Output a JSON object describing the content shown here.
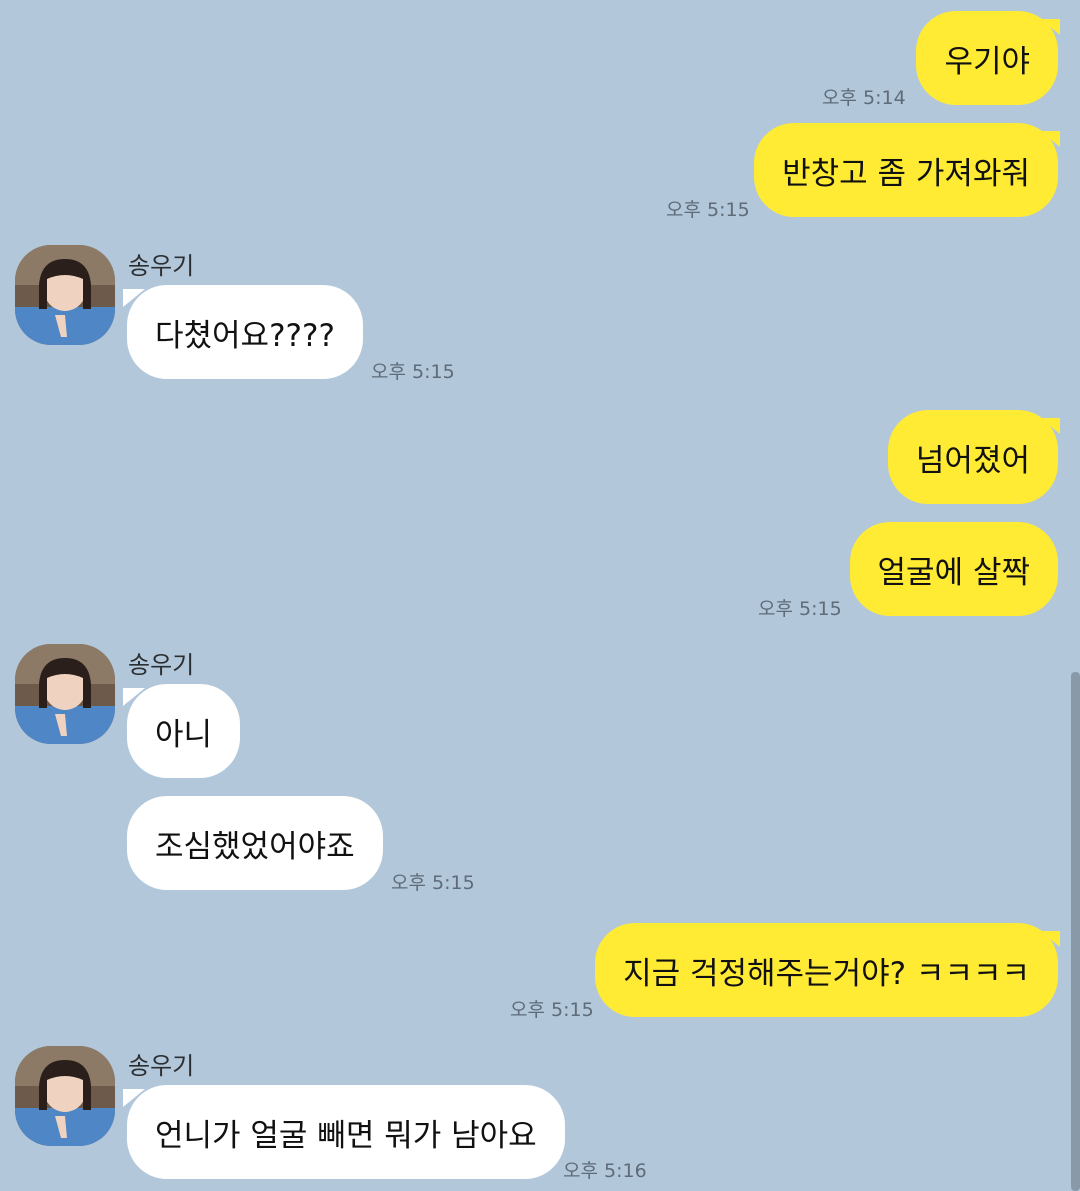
{
  "colors": {
    "background": "#b2c7da",
    "my_bubble": "#ffeb33",
    "their_bubble": "#ffffff",
    "timestamp": "#5f6b78"
  },
  "contact": {
    "name": "송우기",
    "avatar": "profile-photo"
  },
  "messages": [
    {
      "from": "me",
      "text": "우기야",
      "time": "오후 5:14"
    },
    {
      "from": "me",
      "text": "반창고 좀 가져와줘",
      "time": "오후 5:15"
    },
    {
      "from": "them",
      "sender": "송우기",
      "text": "다쳤어요????",
      "time": "오후 5:15"
    },
    {
      "from": "me",
      "text": "넘어졌어",
      "time": ""
    },
    {
      "from": "me",
      "text": "얼굴에 살짝",
      "time": "오후 5:15"
    },
    {
      "from": "them",
      "sender": "송우기",
      "text": "아니",
      "time": ""
    },
    {
      "from": "them",
      "text": "조심했었어야죠",
      "time": "오후 5:15"
    },
    {
      "from": "me",
      "text": "지금 걱정해주는거야? ㅋㅋㅋㅋ",
      "time": "오후 5:15"
    },
    {
      "from": "them",
      "sender": "송우기",
      "text": "언니가 얼굴 빼면 뭐가 남아요",
      "time": "오후 5:16"
    }
  ]
}
